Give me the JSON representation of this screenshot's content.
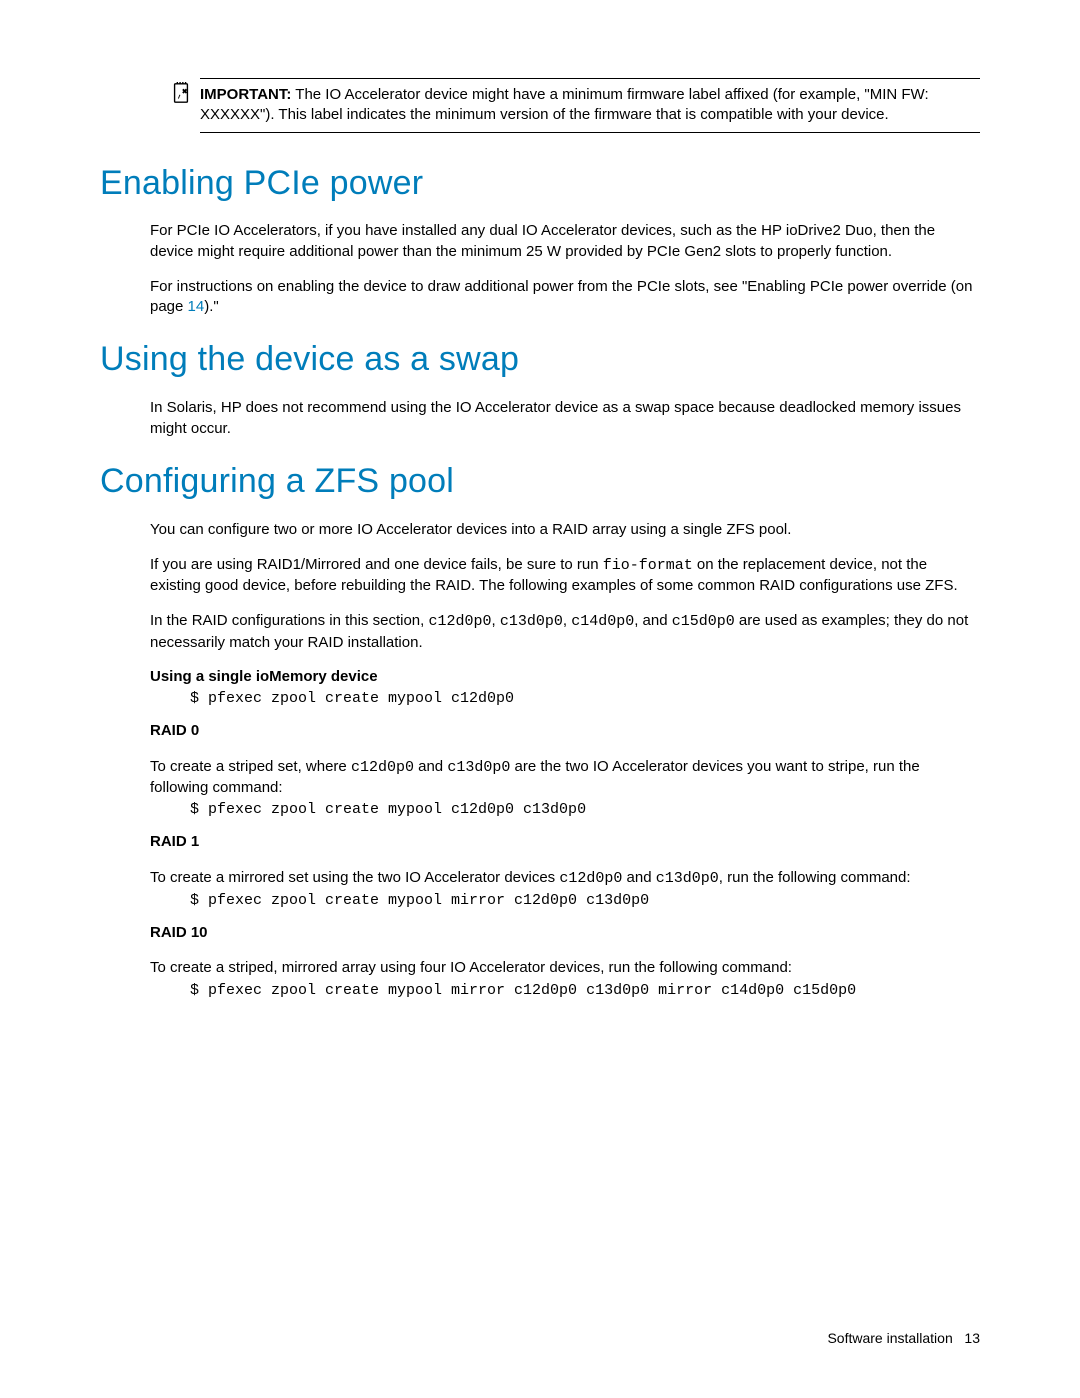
{
  "callout": {
    "important_label": "IMPORTANT:",
    "important_text": "  The IO Accelerator device might have a minimum firmware label affixed (for example, \"MIN FW: XXXXXX\"). This label indicates the minimum version of the firmware that is compatible with your device."
  },
  "sections": {
    "pcie": {
      "heading": "Enabling PCIe power",
      "p1": "For PCIe IO Accelerators, if you have installed any dual IO Accelerator devices, such as the HP ioDrive2 Duo, then the device might require additional power than the minimum 25 W provided by PCIe Gen2 slots to properly function.",
      "p2_pre": "For instructions on enabling the device to draw additional power from the PCIe slots, see \"Enabling PCIe power override (on page ",
      "p2_link": "14",
      "p2_post": ").\""
    },
    "swap": {
      "heading": "Using the device as a swap",
      "p1": "In Solaris, HP does not recommend using the IO Accelerator device as a swap space because deadlocked memory issues might occur."
    },
    "zfs": {
      "heading": "Configuring a ZFS pool",
      "p1": "You can configure two or more IO Accelerator devices into a RAID array using a single ZFS pool.",
      "p2_a": "If you are using RAID1/Mirrored and one device fails, be sure to run ",
      "p2_code": "fio-format",
      "p2_b": " on the replacement device, not the existing good device, before rebuilding the RAID. The following examples of some common RAID configurations use ZFS.",
      "p3_a": "In the RAID configurations in this section, ",
      "p3_c1": "c12d0p0",
      "p3_s1": ", ",
      "p3_c2": "c13d0p0",
      "p3_s2": ", ",
      "p3_c3": "c14d0p0",
      "p3_s3": ", and ",
      "p3_c4": "c15d0p0",
      "p3_b": " are used as examples; they do not necessarily match your RAID installation.",
      "single_head": "Using a single ioMemory device",
      "single_cmd": "$ pfexec zpool create mypool c12d0p0",
      "raid0_head": "RAID 0",
      "raid0_p_a": "To create a striped set, where ",
      "raid0_c1": "c12d0p0",
      "raid0_mid": " and ",
      "raid0_c2": "c13d0p0",
      "raid0_p_b": " are the two IO Accelerator devices you want to stripe, run the following command:",
      "raid0_cmd": "$ pfexec zpool create mypool c12d0p0 c13d0p0",
      "raid1_head": "RAID 1",
      "raid1_p_a": "To create a mirrored set using the two IO Accelerator devices ",
      "raid1_c1": "c12d0p0",
      "raid1_mid": " and ",
      "raid1_c2": "c13d0p0",
      "raid1_p_b": ", run the following command:",
      "raid1_cmd": "$ pfexec zpool create mypool mirror c12d0p0 c13d0p0",
      "raid10_head": "RAID 10",
      "raid10_p": "To create a striped, mirrored array using four IO Accelerator devices, run the following command:",
      "raid10_cmd": "$ pfexec zpool create mypool mirror c12d0p0 c13d0p0 mirror c14d0p0 c15d0p0"
    }
  },
  "footer": {
    "section": "Software installation",
    "page": "13"
  }
}
